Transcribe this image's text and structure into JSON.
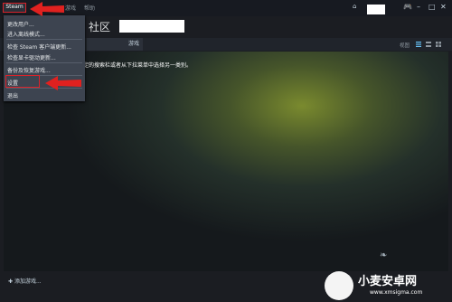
{
  "titlebar": {
    "steam_label": "Steam",
    "menus": [
      "游戏",
      "帮助"
    ]
  },
  "nav": {
    "title": "社区"
  },
  "toolbar": {
    "tab_label": "游戏",
    "view_label": "视图"
  },
  "main": {
    "message": "定的搜索栏或者从下拉菜单中选择另一类别。"
  },
  "dropdown": {
    "items": [
      "更改用户...",
      "进入离线模式...",
      "检查 Steam 客户端更新...",
      "检查显卡驱动更新...",
      "备份及恢复游戏...",
      "设置",
      "退出"
    ]
  },
  "bottom": {
    "add_game": "添加游戏..."
  },
  "watermark": {
    "name": "小麦安卓网",
    "url": "www.xmsigma.com"
  },
  "colors": {
    "highlight": "#d9232a",
    "accent_arrow": "#e0211f"
  }
}
